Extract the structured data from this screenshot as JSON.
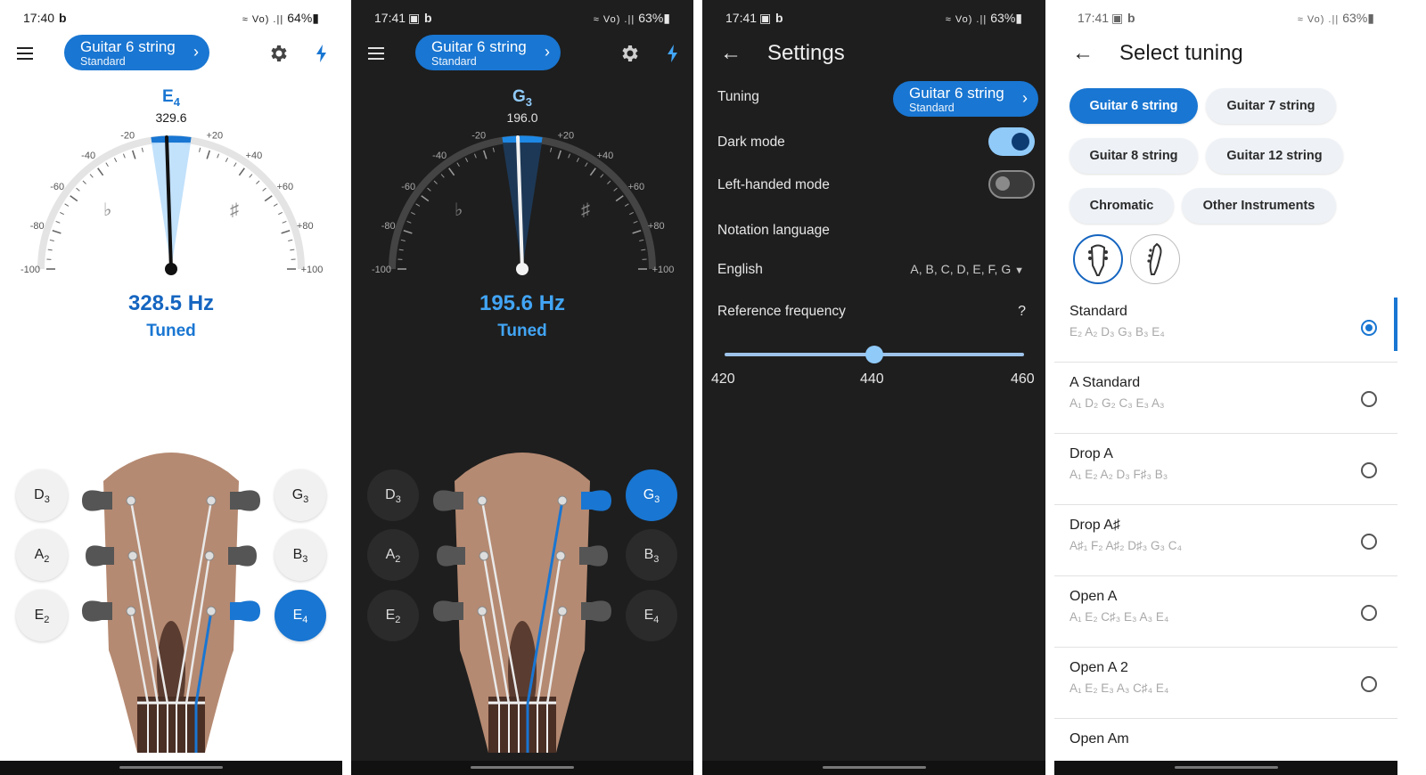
{
  "screens": [
    {
      "status": {
        "time": "17:40",
        "carrier_icon": "b",
        "signal": "≈ ᵛᵒˡ .‧| ",
        "battery": "64%"
      },
      "tuning_pill": {
        "name": "Guitar 6 string",
        "sub": "Standard"
      },
      "note": "E",
      "note_octave": "4",
      "target_freq": "329.6",
      "detected": "328.5 Hz",
      "state": "Tuned",
      "needle_cents": -1,
      "gauge_ticks": [
        "-100",
        "-80",
        "-60",
        "-40",
        "-20",
        "+20",
        "+40",
        "+60",
        "+80",
        "+100"
      ],
      "flat_symbol": "♭",
      "sharp_symbol": "♯",
      "strings_left": [
        {
          "n": "D",
          "o": "3"
        },
        {
          "n": "A",
          "o": "2"
        },
        {
          "n": "E",
          "o": "2"
        }
      ],
      "strings_right": [
        {
          "n": "G",
          "o": "3"
        },
        {
          "n": "B",
          "o": "3"
        },
        {
          "n": "E",
          "o": "4"
        }
      ],
      "active_string": "E4"
    },
    {
      "status": {
        "time": "17:41",
        "carrier_icon": "b",
        "signal": "≈ ᵛᵒˡ .‧| ",
        "battery": "63%"
      },
      "tuning_pill": {
        "name": "Guitar 6 string",
        "sub": "Standard"
      },
      "note": "G",
      "note_octave": "3",
      "target_freq": "196.0",
      "detected": "195.6 Hz",
      "state": "Tuned",
      "needle_cents": -1,
      "gauge_ticks": [
        "-100",
        "-80",
        "-60",
        "-40",
        "-20",
        "+20",
        "+40",
        "+60",
        "+80",
        "+100"
      ],
      "flat_symbol": "♭",
      "sharp_symbol": "♯",
      "strings_left": [
        {
          "n": "D",
          "o": "3"
        },
        {
          "n": "A",
          "o": "2"
        },
        {
          "n": "E",
          "o": "2"
        }
      ],
      "strings_right": [
        {
          "n": "G",
          "o": "3"
        },
        {
          "n": "B",
          "o": "3"
        },
        {
          "n": "E",
          "o": "4"
        }
      ],
      "active_string": "G3"
    }
  ],
  "settings": {
    "status": {
      "time": "17:41",
      "battery": "63%"
    },
    "title": "Settings",
    "tuning_label": "Tuning",
    "tuning_pill": {
      "name": "Guitar 6 string",
      "sub": "Standard"
    },
    "dark_mode_label": "Dark mode",
    "dark_mode_on": true,
    "left_handed_label": "Left-handed mode",
    "left_handed_on": false,
    "notation_label": "Notation language",
    "notation_value": "English",
    "notation_scheme": "A, B, C, D, E, F, G",
    "ref_freq_label": "Reference frequency",
    "help": "?",
    "slider": {
      "min": "420",
      "value": "440",
      "max": "460"
    }
  },
  "select_tuning": {
    "status": {
      "time": "17:41",
      "battery": "63%"
    },
    "title": "Select tuning",
    "chips": [
      "Guitar 6 string",
      "Guitar 7 string",
      "Guitar 8 string",
      "Guitar 12 string",
      "Chromatic",
      "Other Instruments"
    ],
    "selected_chip": "Guitar 6 string",
    "tunings": [
      {
        "name": "Standard",
        "notes": "E₂ A₂ D₃ G₃ B₃ E₄",
        "selected": true
      },
      {
        "name": "A Standard",
        "notes": "A₁ D₂ G₂ C₃ E₃ A₃",
        "selected": false
      },
      {
        "name": "Drop A",
        "notes": "A₁ E₂ A₂ D₃ F♯₃ B₃",
        "selected": false
      },
      {
        "name": "Drop A♯",
        "notes": "A♯₁ F₂ A♯₂ D♯₃ G₃ C₄",
        "selected": false
      },
      {
        "name": "Open A",
        "notes": "A₁ E₂ C♯₃ E₃ A₃ E₄",
        "selected": false
      },
      {
        "name": "Open A 2",
        "notes": "A₁ E₂ E₃ A₃ C♯₄ E₄",
        "selected": false
      },
      {
        "name": "Open Am",
        "notes": "",
        "selected": false
      }
    ]
  },
  "colors": {
    "accent": "#1976d2",
    "accent_dark": "#42a5f5",
    "headstock": "#b58a72",
    "dark_bg": "#1e1e1e"
  }
}
